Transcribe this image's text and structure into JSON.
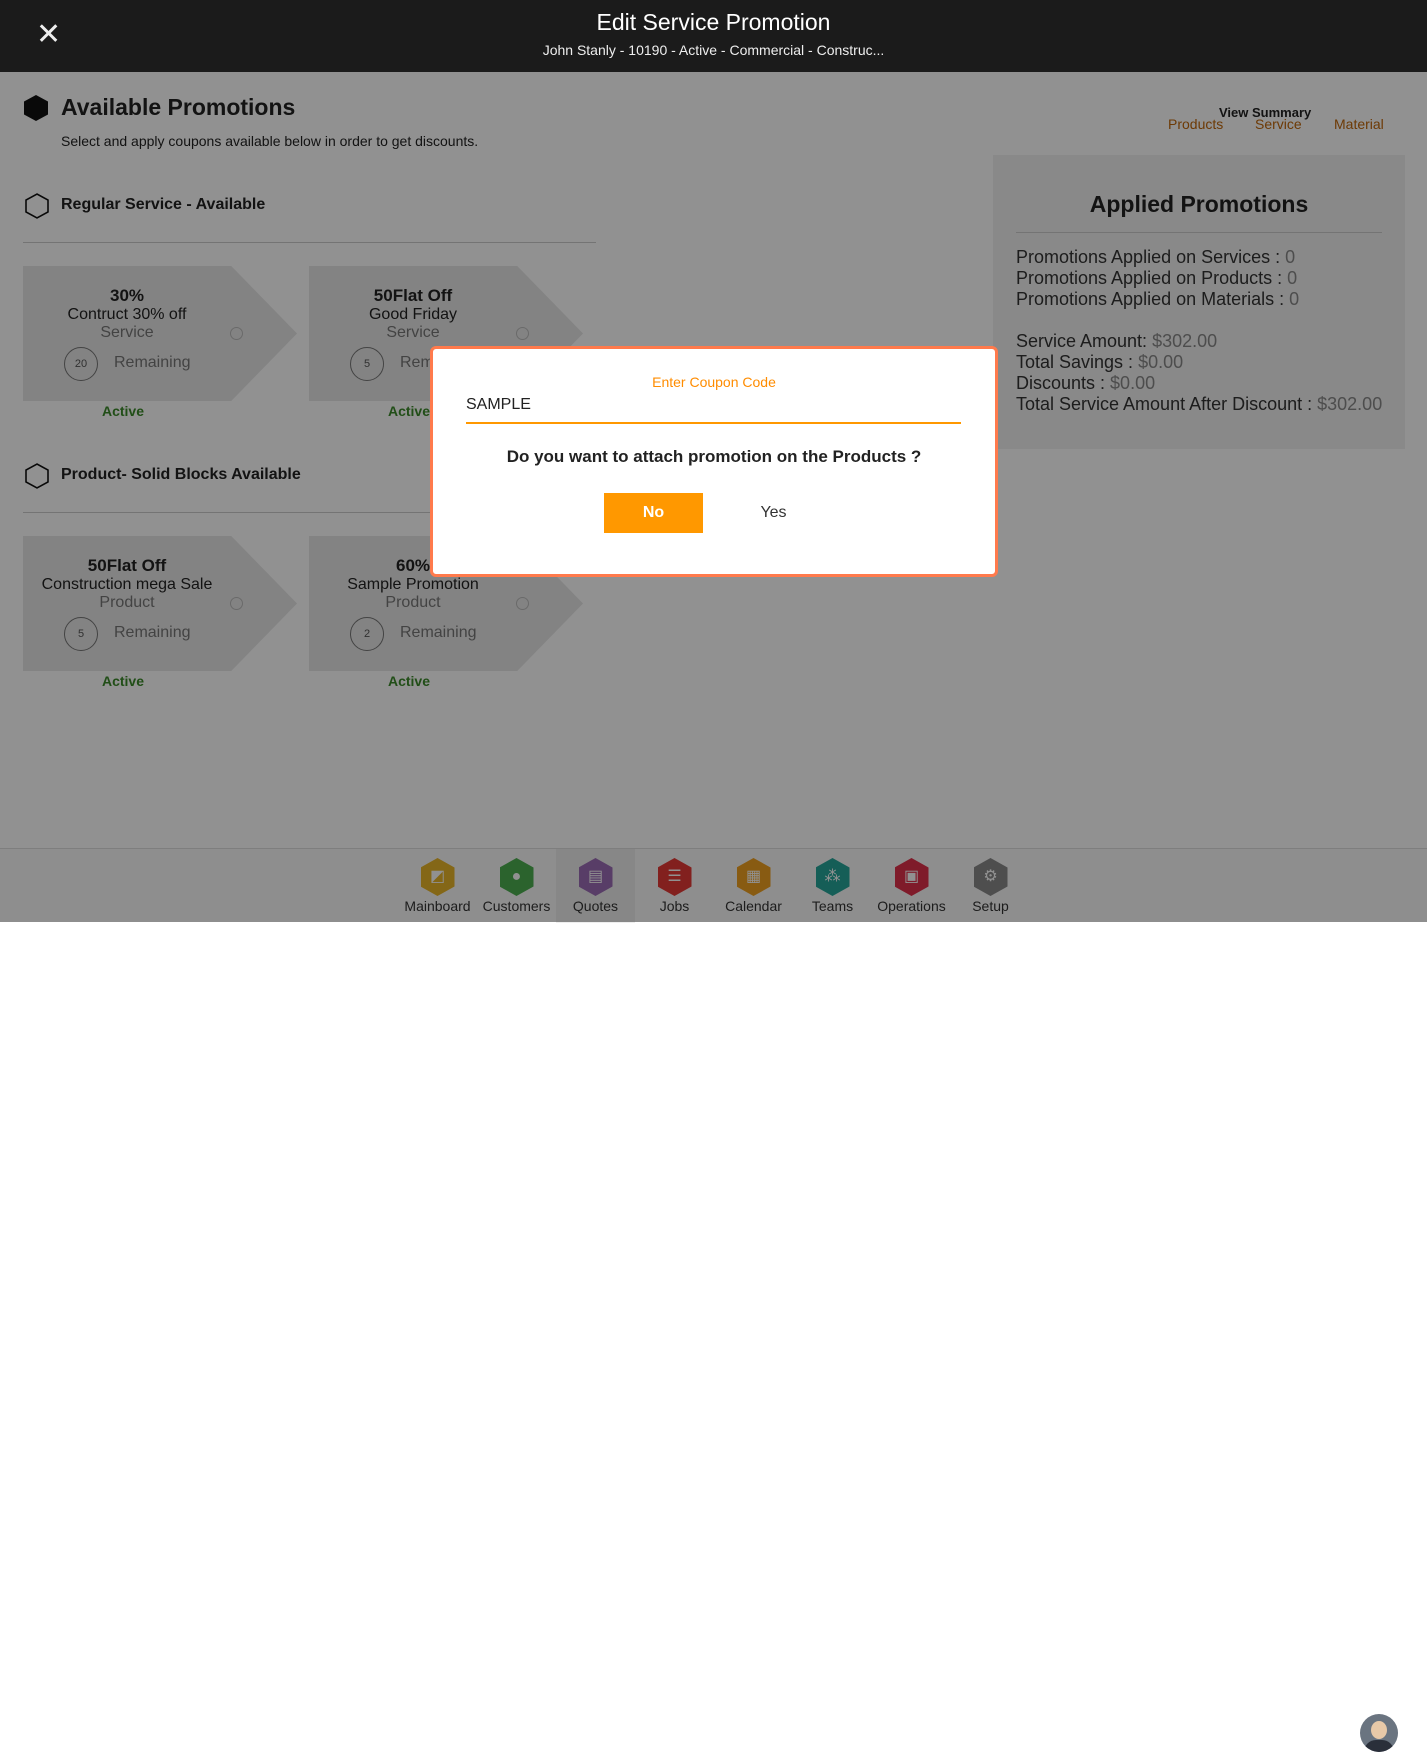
{
  "header": {
    "title": "Edit Service Promotion",
    "subtitle": "John Stanly - 10190 - Active - Commercial - Construc..."
  },
  "main": {
    "title": "Available Promotions",
    "description": "Select and apply coupons available below in order to get discounts.",
    "sections": [
      {
        "title": "Regular Service - Available",
        "cards": [
          {
            "title": "30%",
            "desc": "Contruct 30% off",
            "kind": "Service",
            "count": "20",
            "remaining": "Remaining",
            "status": "Active"
          },
          {
            "title": "50Flat Off",
            "desc": "Good Friday",
            "kind": "Service",
            "count": "5",
            "remaining": "Remaining",
            "status": "Active"
          }
        ]
      },
      {
        "title": "Product- Solid Blocks Available",
        "cards": [
          {
            "title": "50Flat Off",
            "desc": "Construction mega Sale",
            "kind": "Product",
            "count": "5",
            "remaining": "Remaining",
            "status": "Active"
          },
          {
            "title": "60%",
            "desc": "Sample Promotion",
            "kind": "Product",
            "count": "2",
            "remaining": "Remaining",
            "status": "Active"
          }
        ]
      }
    ]
  },
  "summary": {
    "label": "View Summary",
    "tabs": [
      "Products",
      "Service",
      "Material"
    ]
  },
  "applied": {
    "title": "Applied Promotions",
    "rows": [
      {
        "k": "Promotions Applied on Services : ",
        "v": "0"
      },
      {
        "k": "Promotions Applied on Products : ",
        "v": "0"
      },
      {
        "k": "Promotions Applied on Materials : ",
        "v": "0"
      }
    ],
    "amounts": [
      {
        "k": "Service Amount: ",
        "v": "$302.00"
      },
      {
        "k": "Total Savings : ",
        "v": "$0.00"
      },
      {
        "k": "Discounts : ",
        "v": "$0.00"
      },
      {
        "k": "Total Service Amount After Discount : ",
        "v": "$302.00"
      }
    ]
  },
  "dialog": {
    "label": "Enter Coupon Code",
    "value": "SAMPLE",
    "question": "Do you want to attach promotion on the Products ?",
    "no": "No",
    "yes": "Yes"
  },
  "nav": [
    {
      "label": "Mainboard",
      "color": "#e8b62a",
      "icon": "mainboard-icon"
    },
    {
      "label": "Customers",
      "color": "#4caf50",
      "icon": "customers-icon"
    },
    {
      "label": "Quotes",
      "color": "#9b6bb5",
      "icon": "quotes-icon"
    },
    {
      "label": "Jobs",
      "color": "#e53935",
      "icon": "jobs-icon"
    },
    {
      "label": "Calendar",
      "color": "#f0a020",
      "icon": "calendar-icon"
    },
    {
      "label": "Teams",
      "color": "#26a69a",
      "icon": "teams-icon"
    },
    {
      "label": "Operations",
      "color": "#e0304a",
      "icon": "operations-icon"
    },
    {
      "label": "Setup",
      "color": "#8a8a8a",
      "icon": "setup-icon"
    }
  ]
}
